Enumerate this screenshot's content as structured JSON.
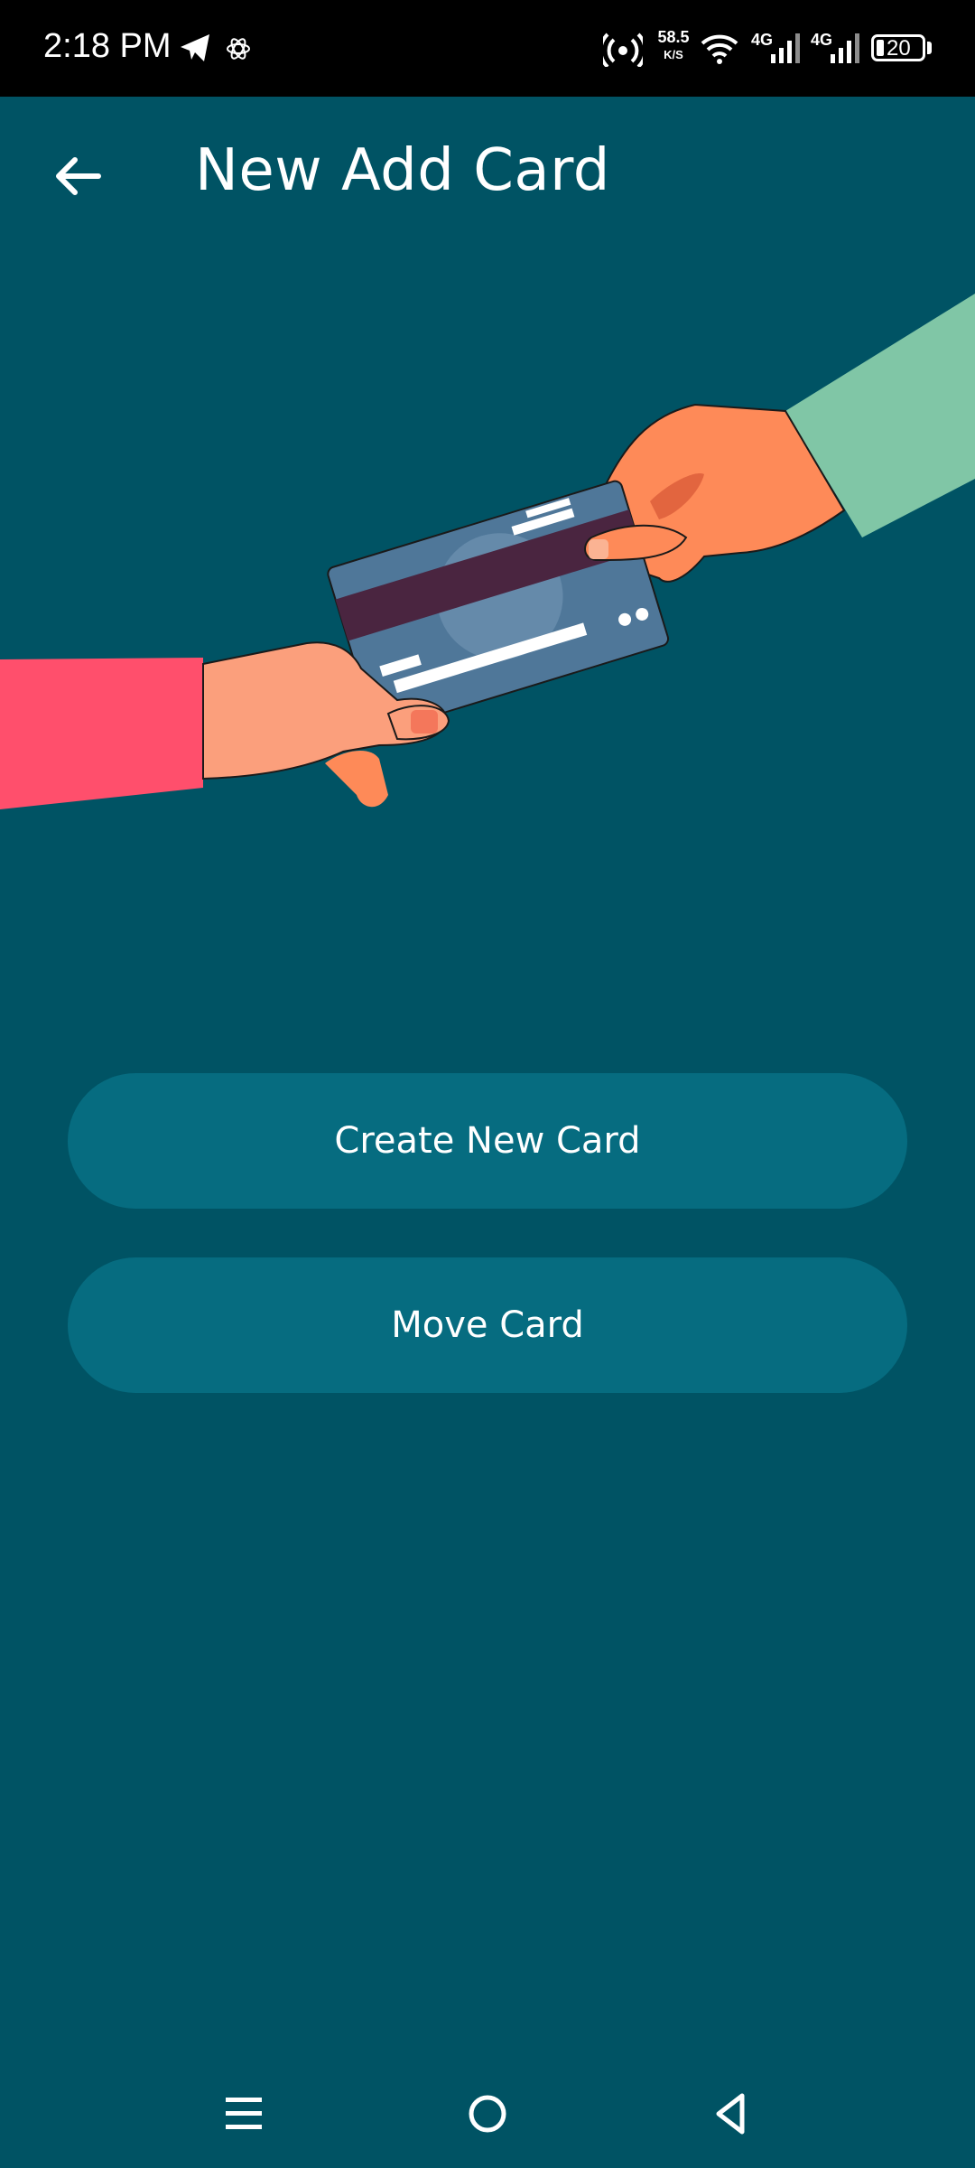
{
  "status_bar": {
    "time": "2:18 PM",
    "net_speed_value": "58.5",
    "net_speed_unit": "K/S",
    "signal1_label": "4G",
    "signal2_label": "4G",
    "battery_level": "20",
    "icons": [
      "telegram-icon",
      "atom-icon",
      "hotspot-icon",
      "wifi-icon",
      "signal-icon",
      "battery-icon"
    ]
  },
  "app_bar": {
    "title": "New Add Card",
    "back_icon": "arrow-left-icon"
  },
  "illustration": {
    "description_icon": "card-handover-illustration",
    "colors": {
      "background": "#005364",
      "card": "#4f7799",
      "stripe": "#4a2540",
      "left_sleeve": "#ff4f6c",
      "right_sleeve": "#80c6a6",
      "skin_left": "#fb9f7c",
      "skin_right": "#fe8a58"
    }
  },
  "actions": {
    "create_label": "Create New Card",
    "move_label": "Move Card",
    "button_color": "#066c80"
  },
  "nav_bar": {
    "icons": [
      "menu-icon",
      "home-icon",
      "back-triangle-icon"
    ]
  }
}
